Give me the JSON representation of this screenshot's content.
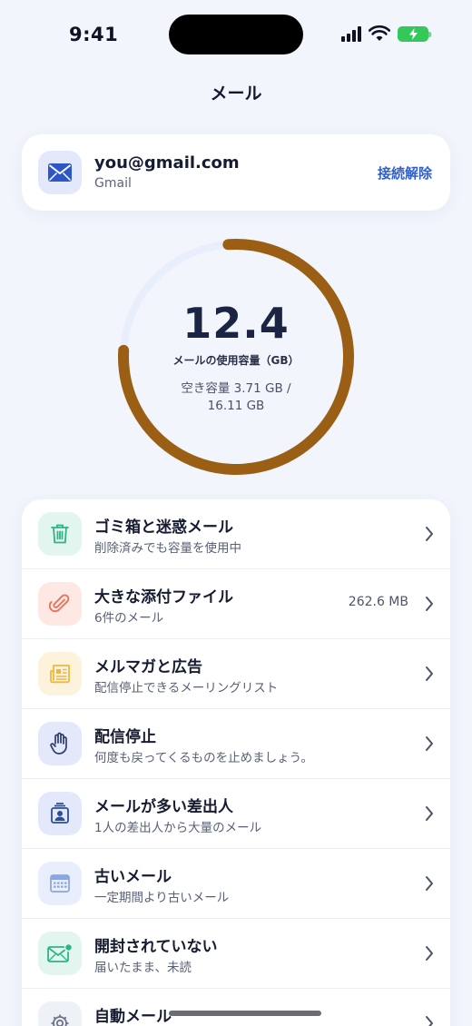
{
  "status_bar": {
    "time": "9:41"
  },
  "nav": {
    "title": "メール"
  },
  "account": {
    "email": "you@gmail.com",
    "provider": "Gmail",
    "disconnect_label": "接続解除"
  },
  "usage": {
    "value": "12.4",
    "label": "メールの使用容量（GB）",
    "free_line1": "空き容量 3.71 GB /",
    "free_line2": "16.11 GB",
    "used_fraction": 0.77,
    "ring_color": "#9a5f14",
    "track_color": "#e8eefc"
  },
  "categories": [
    {
      "title": "ゴミ箱と迷惑メール",
      "subtitle": "削除済みでも容量を使用中",
      "value": "",
      "icon": "trash-icon",
      "icon_bg": "#e2f6ef",
      "icon_color": "#2fb585"
    },
    {
      "title": "大きな添付ファイル",
      "subtitle": "6件のメール",
      "value": "262.6 MB",
      "icon": "paperclip-icon",
      "icon_bg": "#fde8e3",
      "icon_color": "#e8735a"
    },
    {
      "title": "メルマガと広告",
      "subtitle": "配信停止できるメーリングリスト",
      "value": "",
      "icon": "newspaper-icon",
      "icon_bg": "#fdf3dd",
      "icon_color": "#efb73e"
    },
    {
      "title": "配信停止",
      "subtitle": "何度も戻ってくるものを止めましょう。",
      "value": "",
      "icon": "hand-icon",
      "icon_bg": "#e3e9fb",
      "icon_color": "#2b3a6e"
    },
    {
      "title": "メールが多い差出人",
      "subtitle": "1人の差出人から大量のメール",
      "value": "",
      "icon": "contact-icon",
      "icon_bg": "#e3e9fb",
      "icon_color": "#2d4e9a"
    },
    {
      "title": "古いメール",
      "subtitle": "一定期間より古いメール",
      "value": "",
      "icon": "calendar-icon",
      "icon_bg": "#e8eefc",
      "icon_color": "#8aa6e6"
    },
    {
      "title": "開封されていない",
      "subtitle": "届いたまま、未読",
      "value": "",
      "icon": "unread-mail-icon",
      "icon_bg": "#e2f6ef",
      "icon_color": "#2fb585"
    },
    {
      "title": "自動メール",
      "subtitle": "",
      "value": "",
      "icon": "gear-icon",
      "icon_bg": "#eef1f6",
      "icon_color": "#6b7386"
    }
  ]
}
